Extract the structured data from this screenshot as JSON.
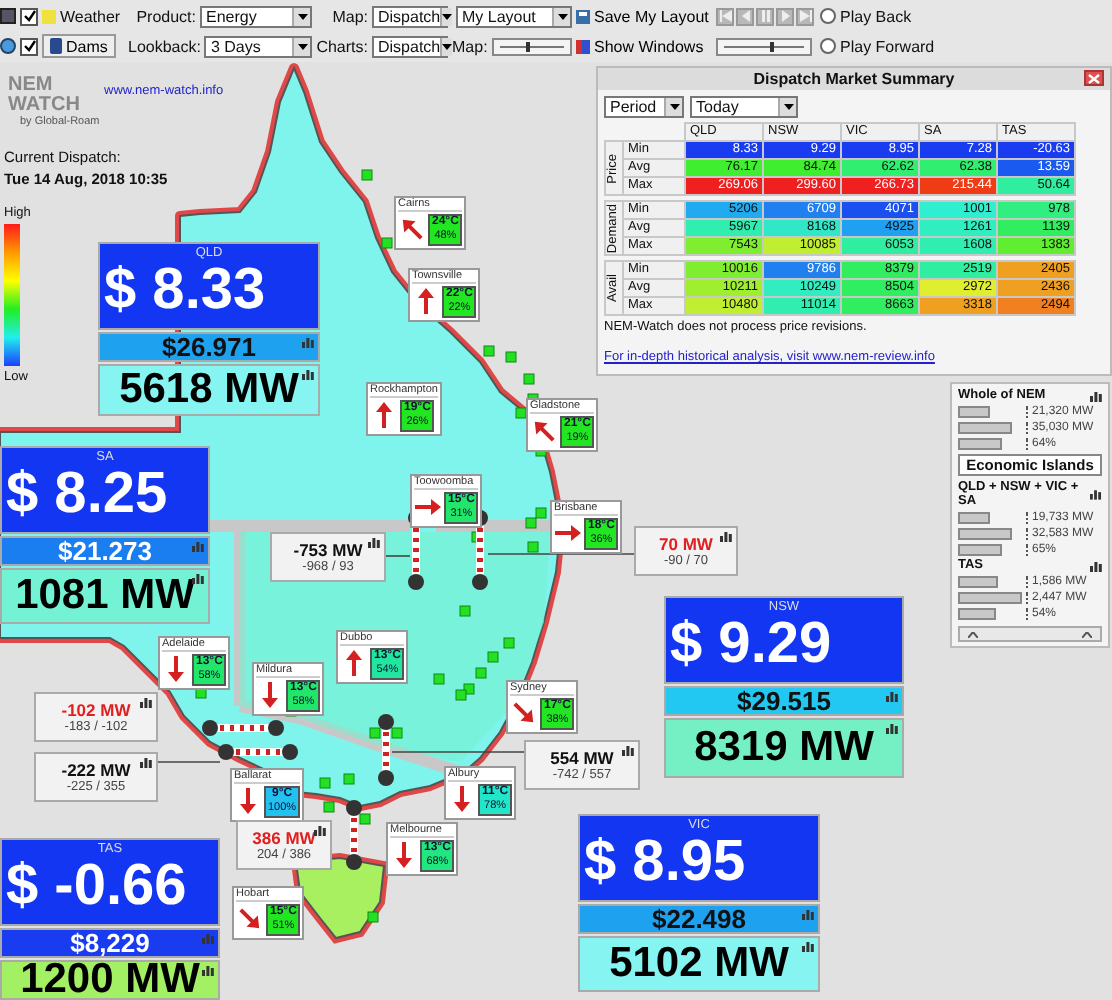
{
  "toolbar": {
    "weather": {
      "label": "Weather",
      "checked": true
    },
    "dams": {
      "label": "Dams",
      "checked": true
    },
    "product": {
      "label": "Product:",
      "value": "Energy"
    },
    "lookback": {
      "label": "Lookback:",
      "value": "3 Days"
    },
    "map": {
      "label": "Map:",
      "value": "Dispatch"
    },
    "charts": {
      "label": "Charts:",
      "value": "Dispatch"
    },
    "layout": {
      "value": "My Layout"
    },
    "save_layout": "Save My Layout",
    "show_windows": "Show Windows",
    "map_slider": {
      "label": "Map:",
      "level": 0.45
    },
    "play_slider": {
      "level": 0.6
    },
    "play_back": {
      "label": "Play Back",
      "selected": false
    },
    "play_forward": {
      "label": "Play Forward",
      "selected": false
    }
  },
  "header": {
    "logo_top": "NEM",
    "logo_bottom": "WATCH",
    "logo_by": "by Global-Roam",
    "link": "www.nem-watch.info",
    "dispatch_label": "Current Dispatch:",
    "dispatch_time": "Tue 14 Aug, 2018 10:35"
  },
  "legend": {
    "high": "High",
    "low": "Low"
  },
  "regions": [
    {
      "name": "QLD",
      "price": {
        "value": "$ 8.33",
        "color": "#1236f2"
      },
      "average": {
        "value": "$26.971",
        "color": "#1ea2f0"
      },
      "demand": {
        "value": "5618 MW",
        "color": "#86f4f0"
      }
    },
    {
      "name": "SA",
      "price": {
        "value": "$ 8.25",
        "color": "#1236f2"
      },
      "average": {
        "value": "$21.273",
        "color": "#1a7ef0"
      },
      "demand": {
        "value": "1081 MW",
        "color": "#74f2d4"
      }
    },
    {
      "name": "NSW",
      "price": {
        "value": "$ 9.29",
        "color": "#1236f2"
      },
      "average": {
        "value": "$29.515",
        "color": "#22c8f2"
      },
      "demand": {
        "value": "8319 MW",
        "color": "#74f0c4"
      }
    },
    {
      "name": "VIC",
      "price": {
        "value": "$ 8.95",
        "color": "#1236f2"
      },
      "average": {
        "value": "$22.498",
        "color": "#1ea2f0"
      },
      "demand": {
        "value": "5102 MW",
        "color": "#86f4f0"
      }
    },
    {
      "name": "TAS",
      "price": {
        "value": "$ -0.66",
        "color": "#1236f2"
      },
      "average": {
        "value": "$8,229",
        "color": "#1a3cf0"
      },
      "demand": {
        "value": "1200 MW",
        "color": "#a4f064"
      }
    }
  ],
  "weather": [
    {
      "name": "Cairns",
      "temperature": "24°C",
      "humidity": "48%",
      "kind": "nw",
      "color": "#22e622"
    },
    {
      "name": "Townsville",
      "temperature": "22°C",
      "humidity": "22%",
      "kind": "n",
      "color": "#22e622"
    },
    {
      "name": "Rockhampton",
      "temperature": "19°C",
      "humidity": "26%",
      "kind": "n",
      "color": "#22e622"
    },
    {
      "name": "Gladstone",
      "temperature": "21°C",
      "humidity": "19%",
      "kind": "nw",
      "color": "#22e622"
    },
    {
      "name": "Toowoomba",
      "temperature": "15°C",
      "humidity": "31%",
      "kind": "e",
      "color": "#22e66a"
    },
    {
      "name": "Brisbane",
      "temperature": "18°C",
      "humidity": "36%",
      "kind": "e",
      "color": "#22e622"
    },
    {
      "name": "Adelaide",
      "temperature": "13°C",
      "humidity": "58%",
      "kind": "s",
      "color": "#22e66a"
    },
    {
      "name": "Mildura",
      "temperature": "13°C",
      "humidity": "58%",
      "kind": "s",
      "color": "#22e66a"
    },
    {
      "name": "Dubbo",
      "temperature": "13°C",
      "humidity": "54%",
      "kind": "n",
      "color": "#22e6a0"
    },
    {
      "name": "Sydney",
      "temperature": "17°C",
      "humidity": "38%",
      "kind": "se",
      "color": "#22e622"
    },
    {
      "name": "Ballarat",
      "temperature": "9°C",
      "humidity": "100%",
      "kind": "s",
      "color": "#22c2f0"
    },
    {
      "name": "Albury",
      "temperature": "11°C",
      "humidity": "78%",
      "kind": "s",
      "color": "#22e6c8"
    },
    {
      "name": "Melbourne",
      "temperature": "13°C",
      "humidity": "68%",
      "kind": "s",
      "color": "#22e680"
    },
    {
      "name": "Hobart",
      "temperature": "15°C",
      "humidity": "51%",
      "kind": "se",
      "color": "#22e622"
    }
  ],
  "interconnectors": [
    {
      "flow": "-753 MW",
      "limits": "-968 / 93",
      "color": "#111111"
    },
    {
      "flow": "70 MW",
      "limits": "-90 / 70",
      "color": "#e02020"
    },
    {
      "flow": "-102 MW",
      "limits": "-183 / -102",
      "color": "#e02020"
    },
    {
      "flow": "-222 MW",
      "limits": "-225 / 355",
      "color": "#111111"
    },
    {
      "flow": "554 MW",
      "limits": "-742 / 557",
      "color": "#111111"
    },
    {
      "flow": "386 MW",
      "limits": "204 / 386",
      "color": "#e02020"
    }
  ],
  "summary": {
    "title": "Dispatch Market Summary",
    "period": "Period",
    "range": "Today",
    "columns": [
      "QLD",
      "NSW",
      "VIC",
      "SA",
      "TAS"
    ],
    "groups": [
      {
        "name": "Price",
        "rows": [
          {
            "label": "Min",
            "cells": [
              {
                "value": "8.33",
                "color": "#1a3cf0"
              },
              {
                "value": "9.29",
                "color": "#1a3cf0"
              },
              {
                "value": "8.95",
                "color": "#1a3cf0"
              },
              {
                "value": "7.28",
                "color": "#1a3cf0"
              },
              {
                "value": "-20.63",
                "color": "#1a3cf0"
              }
            ]
          },
          {
            "label": "Avg",
            "cells": [
              {
                "value": "76.17",
                "color": "#40ee30"
              },
              {
                "value": "84.74",
                "color": "#40ee30"
              },
              {
                "value": "62.62",
                "color": "#30ee70"
              },
              {
                "value": "62.38",
                "color": "#30ee70"
              },
              {
                "value": "13.59",
                "color": "#1a5af0"
              }
            ]
          },
          {
            "label": "Max",
            "cells": [
              {
                "value": "269.06",
                "color": "#f02020"
              },
              {
                "value": "299.60",
                "color": "#f02020"
              },
              {
                "value": "266.73",
                "color": "#f02020"
              },
              {
                "value": "215.44",
                "color": "#f03c14"
              },
              {
                "value": "50.64",
                "color": "#30eea0"
              }
            ]
          }
        ]
      },
      {
        "name": "Demand",
        "rows": [
          {
            "label": "Min",
            "cells": [
              {
                "value": "5206",
                "color": "#20aaf0"
              },
              {
                "value": "6709",
                "color": "#2080f0"
              },
              {
                "value": "4071",
                "color": "#1a50f0"
              },
              {
                "value": "1001",
                "color": "#30eed0"
              },
              {
                "value": "978",
                "color": "#30ee80"
              }
            ]
          },
          {
            "label": "Avg",
            "cells": [
              {
                "value": "5967",
                "color": "#30eeb0"
              },
              {
                "value": "8168",
                "color": "#30e8c8"
              },
              {
                "value": "4925",
                "color": "#20a0f0"
              },
              {
                "value": "1261",
                "color": "#30eec0"
              },
              {
                "value": "1139",
                "color": "#30ee60"
              }
            ]
          },
          {
            "label": "Max",
            "cells": [
              {
                "value": "7543",
                "color": "#80ee30"
              },
              {
                "value": "10085",
                "color": "#c0ee30"
              },
              {
                "value": "6053",
                "color": "#30eea0"
              },
              {
                "value": "1608",
                "color": "#30eeb0"
              },
              {
                "value": "1383",
                "color": "#60ee30"
              }
            ]
          }
        ]
      },
      {
        "name": "Avail",
        "rows": [
          {
            "label": "Min",
            "cells": [
              {
                "value": "10016",
                "color": "#80ee30"
              },
              {
                "value": "9786",
                "color": "#2080f0"
              },
              {
                "value": "8379",
                "color": "#30ee60"
              },
              {
                "value": "2519",
                "color": "#30eea0"
              },
              {
                "value": "2405",
                "color": "#f0a020"
              }
            ]
          },
          {
            "label": "Avg",
            "cells": [
              {
                "value": "10211",
                "color": "#a0ee30"
              },
              {
                "value": "10249",
                "color": "#30eec0"
              },
              {
                "value": "8504",
                "color": "#30ee60"
              },
              {
                "value": "2972",
                "color": "#e0ee30"
              },
              {
                "value": "2436",
                "color": "#f0a020"
              }
            ]
          },
          {
            "label": "Max",
            "cells": [
              {
                "value": "10480",
                "color": "#c0ee30"
              },
              {
                "value": "11014",
                "color": "#30eeb0"
              },
              {
                "value": "8663",
                "color": "#30ee60"
              },
              {
                "value": "3318",
                "color": "#f0a020"
              },
              {
                "value": "2494",
                "color": "#f08020"
              }
            ]
          }
        ]
      }
    ],
    "note": "NEM-Watch does not process price revisions.",
    "link": "For in-depth historical analysis, visit www.nem-review.info"
  },
  "nem_panel": {
    "islands_label": "Economic Islands",
    "sections": [
      {
        "title": "Whole of NEM",
        "bars": [
          {
            "value": "21,320 MW",
            "level": 0.48
          },
          {
            "value": "35,030 MW",
            "level": 0.8
          },
          {
            "value": "64%",
            "level": 0.65
          }
        ]
      },
      {
        "title": "QLD + NSW + VIC + SA",
        "bars": [
          {
            "value": "19,733 MW",
            "level": 0.48
          },
          {
            "value": "32,583 MW",
            "level": 0.78
          },
          {
            "value": "65%",
            "level": 0.65
          }
        ]
      },
      {
        "title": "TAS",
        "bars": [
          {
            "value": "1,586 MW",
            "level": 0.6
          },
          {
            "value": "2,447 MW",
            "level": 0.95
          },
          {
            "value": "54%",
            "level": 0.55
          }
        ]
      }
    ]
  }
}
